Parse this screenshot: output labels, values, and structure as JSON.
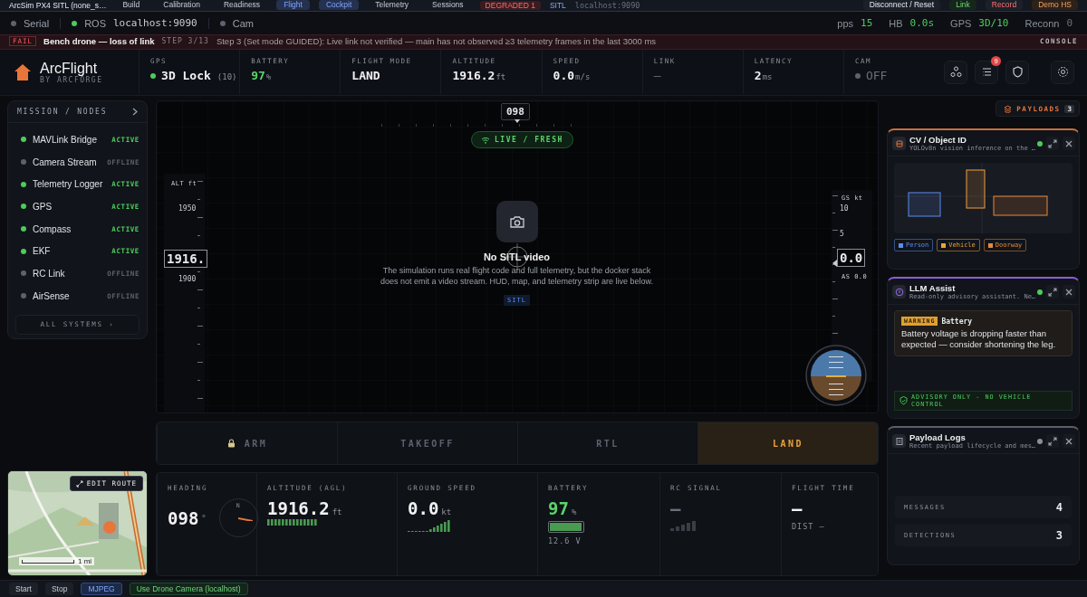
{
  "top_nav": {
    "project": "ArcSim PX4 SITL (none_s…",
    "tabs": [
      {
        "label": "Build",
        "selected": false
      },
      {
        "label": "Calibration",
        "selected": false
      },
      {
        "label": "Readiness",
        "selected": false
      },
      {
        "label": "Flight",
        "selected": true
      }
    ],
    "views": [
      {
        "label": "Cockpit",
        "selected": true
      },
      {
        "label": "Telemetry",
        "selected": false
      },
      {
        "label": "Sessions",
        "selected": false
      }
    ],
    "health": {
      "label": "DEGRADED",
      "count": "1"
    },
    "connection": {
      "label": "SITL",
      "address": "localhost:9090"
    },
    "actions": [
      {
        "label": "Disconnect / Reset",
        "kind": "plain"
      },
      {
        "label": "Link",
        "kind": "good"
      },
      {
        "label": "Record",
        "kind": "record"
      },
      {
        "label": "Demo HS",
        "kind": "warn"
      }
    ]
  },
  "status_bar": {
    "sources": [
      {
        "label": "Serial",
        "on": false
      },
      {
        "label": "ROS",
        "value": "localhost:9090",
        "on": true
      },
      {
        "label": "Cam",
        "on": false
      }
    ],
    "metrics": [
      {
        "label": "pps",
        "value": "15",
        "good": true
      },
      {
        "label": "HB",
        "value": "0.0s",
        "good": true
      },
      {
        "label": "GPS",
        "value": "3D/10",
        "good": true
      },
      {
        "label": "Reconn",
        "value": "0",
        "good": false
      }
    ]
  },
  "alert": {
    "badge": "FAIL",
    "title": "Bench drone — loss of link",
    "step": "STEP 3/13",
    "message": "Step 3 (Set mode GUIDED): Live link not verified — main has not observed ≥3 telemetry frames in the last 3000 ms",
    "action": "CONSOLE"
  },
  "brand": {
    "name": "ArcFlight",
    "tagline": "BY ARCFORGE"
  },
  "telemetry": [
    {
      "label": "GPS",
      "kind": "dot",
      "on": true,
      "value": "3D Lock",
      "detail": "(10)",
      "good": false,
      "muted": false
    },
    {
      "label": "BATTERY",
      "kind": "unit",
      "value": "97",
      "unit": "%",
      "good": true,
      "muted": false
    },
    {
      "label": "FLIGHT MODE",
      "kind": "unit",
      "value": "LAND",
      "good": false,
      "muted": false
    },
    {
      "label": "ALTITUDE",
      "kind": "unit",
      "value": "1916.2",
      "unit": "ft",
      "good": false,
      "muted": false
    },
    {
      "label": "SPEED",
      "kind": "unit",
      "value": "0.0",
      "unit": "m/s",
      "good": false,
      "muted": false
    },
    {
      "label": "LINK",
      "kind": "unit",
      "value": "—",
      "good": false,
      "muted": true
    },
    {
      "label": "LATENCY",
      "kind": "unit",
      "value": "2",
      "unit": "ms",
      "good": false,
      "muted": false
    },
    {
      "label": "CAM",
      "kind": "dot",
      "on": false,
      "value": "OFF",
      "good": false,
      "muted": true
    }
  ],
  "header_tools": {
    "notifications": "9"
  },
  "sidebar": {
    "title": "MISSION / NODES",
    "nodes": [
      {
        "name": "MAVLink Bridge",
        "status": "ACTIVE",
        "active": true
      },
      {
        "name": "Camera Stream",
        "status": "OFFLINE",
        "active": false
      },
      {
        "name": "Telemetry Logger",
        "status": "ACTIVE",
        "active": true
      },
      {
        "name": "GPS",
        "status": "ACTIVE",
        "active": true
      },
      {
        "name": "Compass",
        "status": "ACTIVE",
        "active": true
      },
      {
        "name": "EKF",
        "status": "ACTIVE",
        "active": true
      },
      {
        "name": "RC Link",
        "status": "OFFLINE",
        "active": false
      },
      {
        "name": "AirSense",
        "status": "OFFLINE",
        "active": false
      }
    ],
    "footer": "ALL SYSTEMS ›"
  },
  "hud": {
    "heading": "098",
    "link": {
      "label": "LIVE / FRESH",
      "fresh": true
    },
    "altitude_tape": {
      "label": "ALT ft",
      "ticks": [
        "1950",
        "1900"
      ],
      "value": "1916."
    },
    "speed_tape": {
      "label": "GS kt",
      "ticks": [
        "10",
        "5"
      ],
      "value": "0.0",
      "airspeed": "AS 0.0"
    },
    "no_video": {
      "title": "No SITL video",
      "message": "The simulation runs real flight code and full telemetry, but the docker stack does not emit a video stream. HUD, map, and telemetry strip are live below.",
      "tag": "SITL"
    }
  },
  "commands": [
    {
      "label": "ARM",
      "locked": true,
      "selected": false
    },
    {
      "label": "TAKEOFF",
      "locked": false,
      "selected": false
    },
    {
      "label": "RTL",
      "locked": false,
      "selected": false
    },
    {
      "label": "LAND",
      "locked": false,
      "selected": true
    }
  ],
  "stats": [
    {
      "kind": "heading",
      "label": "HEADING",
      "value": "098",
      "unit": "°",
      "dial": "N"
    },
    {
      "kind": "altitude",
      "label": "ALTITUDE (AGL)",
      "value": "1916.2",
      "unit": "ft"
    },
    {
      "kind": "speed",
      "label": "GROUND SPEED",
      "value": "0.0",
      "unit": "kt"
    },
    {
      "kind": "battery",
      "label": "BATTERY",
      "value": "97",
      "unit": "%",
      "level": 0.97,
      "detail": "12.6 V"
    },
    {
      "kind": "signal",
      "label": "RC SIGNAL",
      "value": "—"
    },
    {
      "kind": "time",
      "label": "FLIGHT TIME",
      "value": "—",
      "detail": "DIST —"
    }
  ],
  "map": {
    "kind": "picture",
    "edit_button": "EDIT ROUTE",
    "scale": "1 mi"
  },
  "payloads": {
    "label": "PAYLOADS",
    "count": "3",
    "panels": [
      {
        "kind": "vision",
        "title": "CV / Object ID",
        "subtitle": "YOLOv8n vision inference on the …",
        "online": true,
        "color": "#c8703a",
        "legend": [
          {
            "label": "Person",
            "color": "#5b8def"
          },
          {
            "label": "Vehicle",
            "color": "#f0a040"
          },
          {
            "label": "Doorway",
            "color": "#e8883a"
          }
        ]
      },
      {
        "kind": "assistant",
        "title": "LLM Assist",
        "subtitle": "Read-only advisory assistant. Ne…",
        "online": true,
        "color": "#8a5cd8",
        "advice": {
          "level": "WARNING",
          "title": "Battery",
          "message": "Battery voltage is dropping faster than expected — consider shortening the leg."
        },
        "footer": "ADVISORY ONLY - NO VEHICLE CONTROL"
      },
      {
        "kind": "logs",
        "title": "Payload Logs",
        "subtitle": "Recent payload lifecycle and mes…",
        "online": false,
        "color": "#5a606c",
        "counters": [
          {
            "label": "MESSAGES",
            "value": "4"
          },
          {
            "label": "DETECTIONS",
            "value": "3"
          }
        ]
      }
    ]
  },
  "bottom_bar": {
    "controls": [
      {
        "label": "Start",
        "kind": "plain",
        "selected": false
      },
      {
        "label": "Stop",
        "kind": "plain",
        "selected": false
      },
      {
        "label": "MJPEG",
        "kind": "plain",
        "selected": true
      },
      {
        "label": "Use Drone Camera (localhost)",
        "kind": "good",
        "selected": false
      }
    ]
  }
}
